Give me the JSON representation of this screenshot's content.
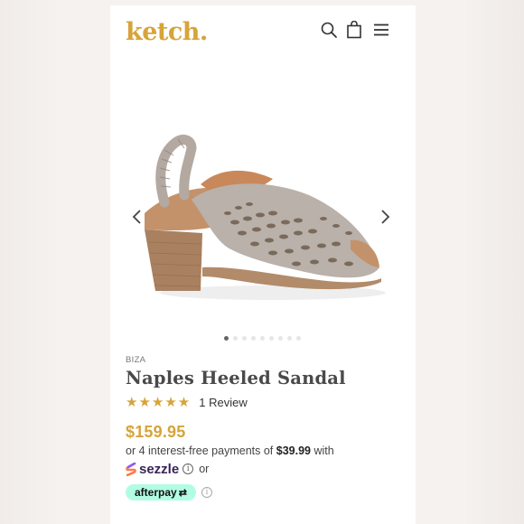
{
  "header": {
    "logo": "ketch.",
    "icons": [
      "search-icon",
      "shopping-bag-icon",
      "menu-icon"
    ]
  },
  "gallery": {
    "image": "taupe perforated leather slingback heeled sandal",
    "dot_count": 9,
    "active_dot": 1
  },
  "product": {
    "brand": "BIZA",
    "title": "Naples Heeled Sandal",
    "stars": "★★★★★",
    "rating": 5,
    "review_label": "1 Review",
    "price": "$159.95",
    "installments_prefix": "or 4 interest-free payments of ",
    "installment_amount": "$39.99",
    "installments_suffix": " with",
    "sezzle_label": "sezzle",
    "or_label": "or",
    "afterpay_label": "afterpay"
  },
  "colors": {
    "accent": "#d6a43a",
    "afterpay": "#b2fce4",
    "sezzle": "#392558"
  }
}
